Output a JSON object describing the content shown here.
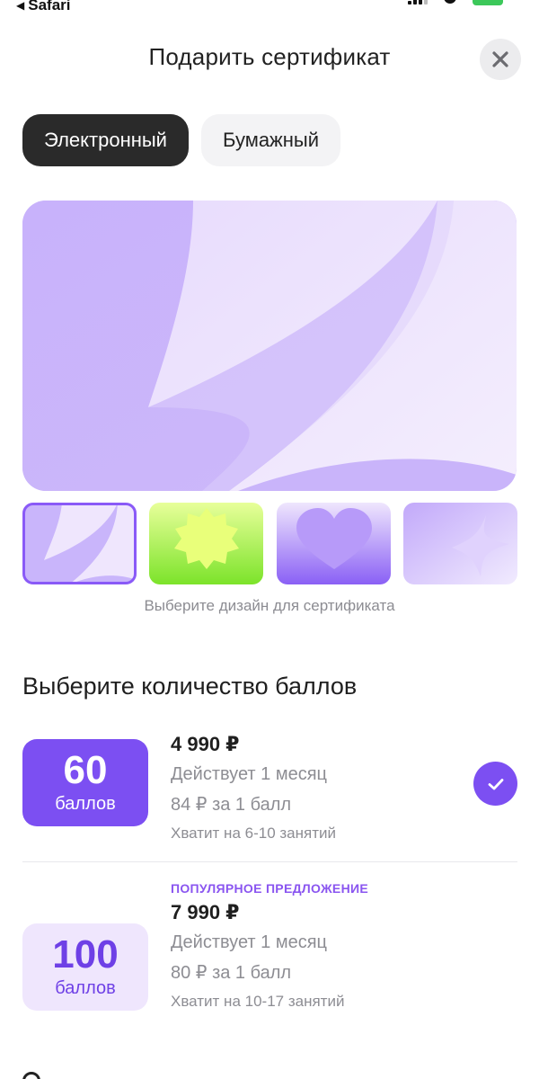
{
  "status_bar": {
    "back_label": "Safari",
    "back_icon": "back-arrow-icon"
  },
  "header": {
    "title": "Подарить сертификат",
    "close_icon": "close-icon"
  },
  "tabs": [
    {
      "label": "Электронный",
      "active": true
    },
    {
      "label": "Бумажный",
      "active": false
    }
  ],
  "designs": {
    "hint": "Выберите дизайн для сертификата",
    "options": [
      {
        "name": "lavender-petals",
        "selected": true
      },
      {
        "name": "lime-starburst",
        "selected": false
      },
      {
        "name": "purple-heart",
        "selected": false
      },
      {
        "name": "lilac-sparkle",
        "selected": false
      }
    ]
  },
  "points_section": {
    "title": "Выберите количество баллов",
    "plans": [
      {
        "points": "60",
        "unit": "баллов",
        "popular_tag": "",
        "price": "4 990 ₽",
        "validity": "Действует 1 месяц",
        "per_point": "84 ₽ за 1 балл",
        "lessons": "Хватит на 6-10 занятий",
        "selected": true
      },
      {
        "points": "100",
        "unit": "баллов",
        "popular_tag": "ПОПУЛЯРНОЕ ПРЕДЛОЖЕНИЕ",
        "price": "7 990 ₽",
        "validity": "Действует 1 месяц",
        "per_point": "80 ₽ за 1 балл",
        "lessons": "Хватит на 10-17 занятий",
        "selected": false
      }
    ]
  },
  "colors": {
    "accent": "#7c4ff2",
    "accent_light": "#efe6fd",
    "tab_active": "#2a2a2a",
    "muted_text": "#8d8d93"
  }
}
